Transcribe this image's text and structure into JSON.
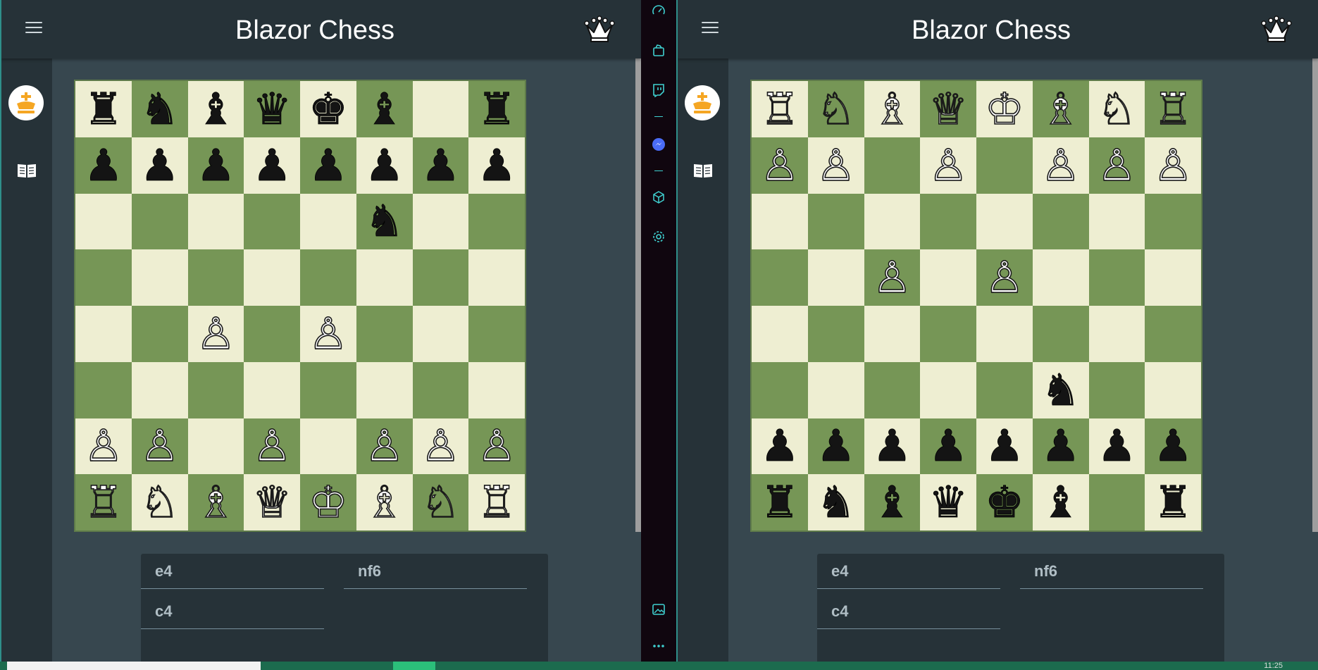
{
  "windows": [
    {
      "title": "Blazor Chess",
      "board": [
        [
          "br",
          "bn",
          "bb",
          "bq",
          "bk",
          "bb",
          "",
          "br"
        ],
        [
          "bp",
          "bp",
          "bp",
          "bp",
          "bp",
          "bp",
          "bp",
          "bp"
        ],
        [
          "",
          "",
          "",
          "",
          "",
          "bn",
          "",
          ""
        ],
        [
          "",
          "",
          "",
          "",
          "",
          "",
          "",
          ""
        ],
        [
          "",
          "",
          "wp",
          "",
          "wp",
          "",
          "",
          ""
        ],
        [
          "",
          "",
          "",
          "",
          "",
          "",
          "",
          ""
        ],
        [
          "wp",
          "wp",
          "",
          "wp",
          "",
          "wp",
          "wp",
          "wp"
        ],
        [
          "wr",
          "wn",
          "wb",
          "wq",
          "wk",
          "wb",
          "wn",
          "wr"
        ]
      ],
      "moves": {
        "white": [
          "e4",
          "c4"
        ],
        "black": [
          "nf6"
        ]
      }
    },
    {
      "title": "Blazor Chess",
      "board": [
        [
          "wr",
          "wn",
          "wb",
          "wq",
          "wk",
          "wb",
          "wn",
          "wr"
        ],
        [
          "wp",
          "wp",
          "",
          "wp",
          "",
          "wp",
          "wp",
          "wp"
        ],
        [
          "",
          "",
          "",
          "",
          "",
          "",
          "",
          ""
        ],
        [
          "",
          "",
          "wp",
          "",
          "wp",
          "",
          "",
          ""
        ],
        [
          "",
          "",
          "",
          "",
          "",
          "",
          "",
          ""
        ],
        [
          "",
          "",
          "",
          "",
          "",
          "bn",
          "",
          ""
        ],
        [
          "bp",
          "bp",
          "bp",
          "bp",
          "bp",
          "bp",
          "bp",
          "bp"
        ],
        [
          "br",
          "bn",
          "bb",
          "bq",
          "bk",
          "bb",
          "",
          "br"
        ]
      ],
      "moves": {
        "white": [
          "e4",
          "c4"
        ],
        "black": [
          "nf6"
        ]
      }
    }
  ],
  "pieces": {
    "wk": "♔",
    "wq": "♕",
    "wr": "♖",
    "wb": "♗",
    "wn": "♘",
    "wp": "♙",
    "bk": "♚",
    "bq": "♛",
    "br": "♜",
    "bb": "♝",
    "bn": "♞",
    "bp": "♟"
  },
  "colors": {
    "light_square": "#eeeed2",
    "dark_square": "#769656",
    "app_bar": "#263238",
    "background": "#37474f",
    "avatar_accent": "#f5a623"
  },
  "edge_bar": {
    "icons": [
      "speedometer-icon",
      "shopping-bag-icon",
      "twitch-icon",
      "messenger-icon",
      "cube-icon",
      "settings-icon",
      "image-icon",
      "more-icon"
    ]
  },
  "taskbar": {
    "time": "11:25"
  }
}
